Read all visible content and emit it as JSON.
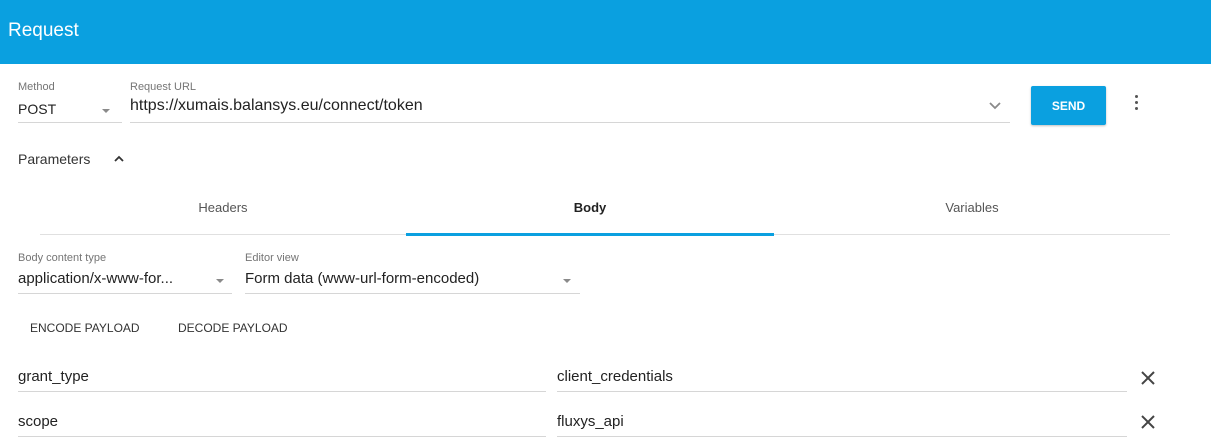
{
  "header": {
    "title": "Request"
  },
  "request": {
    "method_caption": "Method",
    "method_value": "POST",
    "url_caption": "Request URL",
    "url_value": "https://xumais.balansys.eu/connect/token",
    "send_label": "SEND"
  },
  "parameters": {
    "label": "Parameters"
  },
  "tabs": [
    {
      "label": "Headers"
    },
    {
      "label": "Body"
    },
    {
      "label": "Variables"
    }
  ],
  "body": {
    "content_type_caption": "Body content type",
    "content_type_value": "application/x-www-for...",
    "editor_view_caption": "Editor view",
    "editor_view_value": "Form data (www-url-form-encoded)",
    "encode_label": "ENCODE PAYLOAD",
    "decode_label": "DECODE PAYLOAD"
  },
  "form_rows": [
    {
      "name": "grant_type",
      "value": "client_credentials"
    },
    {
      "name": "scope",
      "value": "fluxys_api"
    }
  ],
  "colors": {
    "accent": "#0aa0e0"
  },
  "icons": [
    "chevron-down-icon",
    "more-vert-icon",
    "chevron-up-icon",
    "close-icon"
  ]
}
